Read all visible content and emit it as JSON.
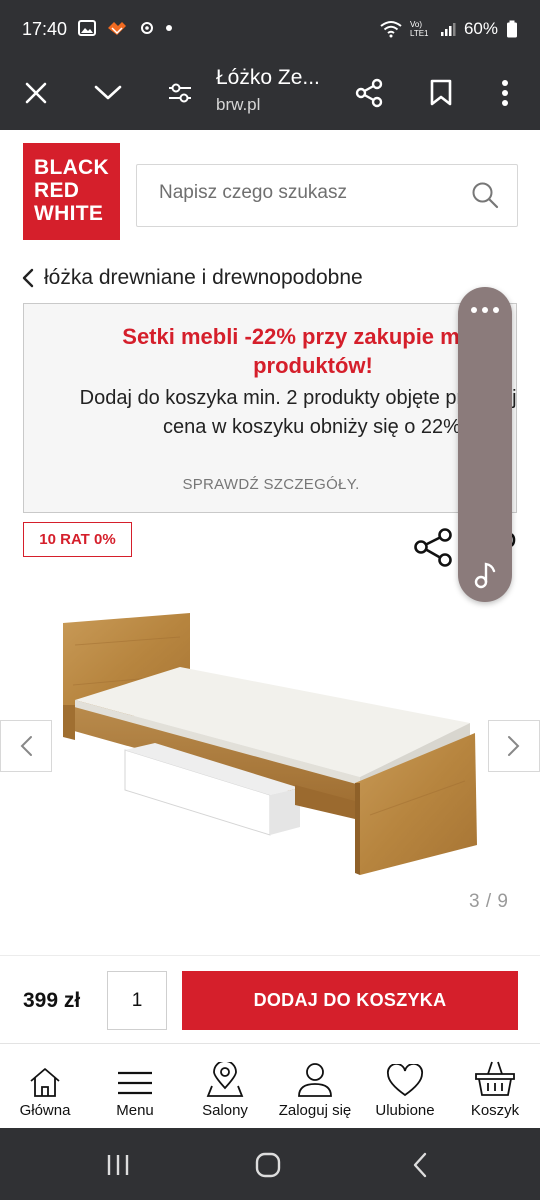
{
  "status_bar": {
    "time": "17:40",
    "battery": "60%",
    "network": "Vo) LTE1"
  },
  "browser": {
    "title": "Łóżko Ze...",
    "url": "brw.pl"
  },
  "logo": {
    "line1": "BLACK",
    "line2": "RED",
    "line3": "WHITE"
  },
  "search": {
    "placeholder": "Napisz czego szukasz"
  },
  "breadcrumb": {
    "label": "łóżka drewniane i drewnopodobne"
  },
  "promo": {
    "title": "Setki mebli -22% przy zakupie min. 2 produktów!",
    "description": "Dodaj do koszyka min. 2 produkty objęte promocją a cena w koszyku obniży się o 22%",
    "link": "SPRAWDŹ SZCZEGÓŁY."
  },
  "badge": {
    "label": "10 RAT 0%"
  },
  "gallery": {
    "counter": "3 / 9"
  },
  "purchase": {
    "price": "399 zł",
    "quantity": "1",
    "add_to_cart": "DODAJ DO KOSZYKA"
  },
  "bottom_nav": {
    "items": [
      {
        "label": "Główna",
        "icon": "home-icon"
      },
      {
        "label": "Menu",
        "icon": "menu-icon"
      },
      {
        "label": "Salony",
        "icon": "map-pin-icon"
      },
      {
        "label": "Zaloguj się",
        "icon": "user-icon"
      },
      {
        "label": "Ulubione",
        "icon": "heart-icon"
      },
      {
        "label": "Koszyk",
        "icon": "basket-icon"
      }
    ]
  },
  "colors": {
    "brand_red": "#d51f2b",
    "system_bar": "#303134",
    "floating_panel": "#8b7b7b"
  }
}
